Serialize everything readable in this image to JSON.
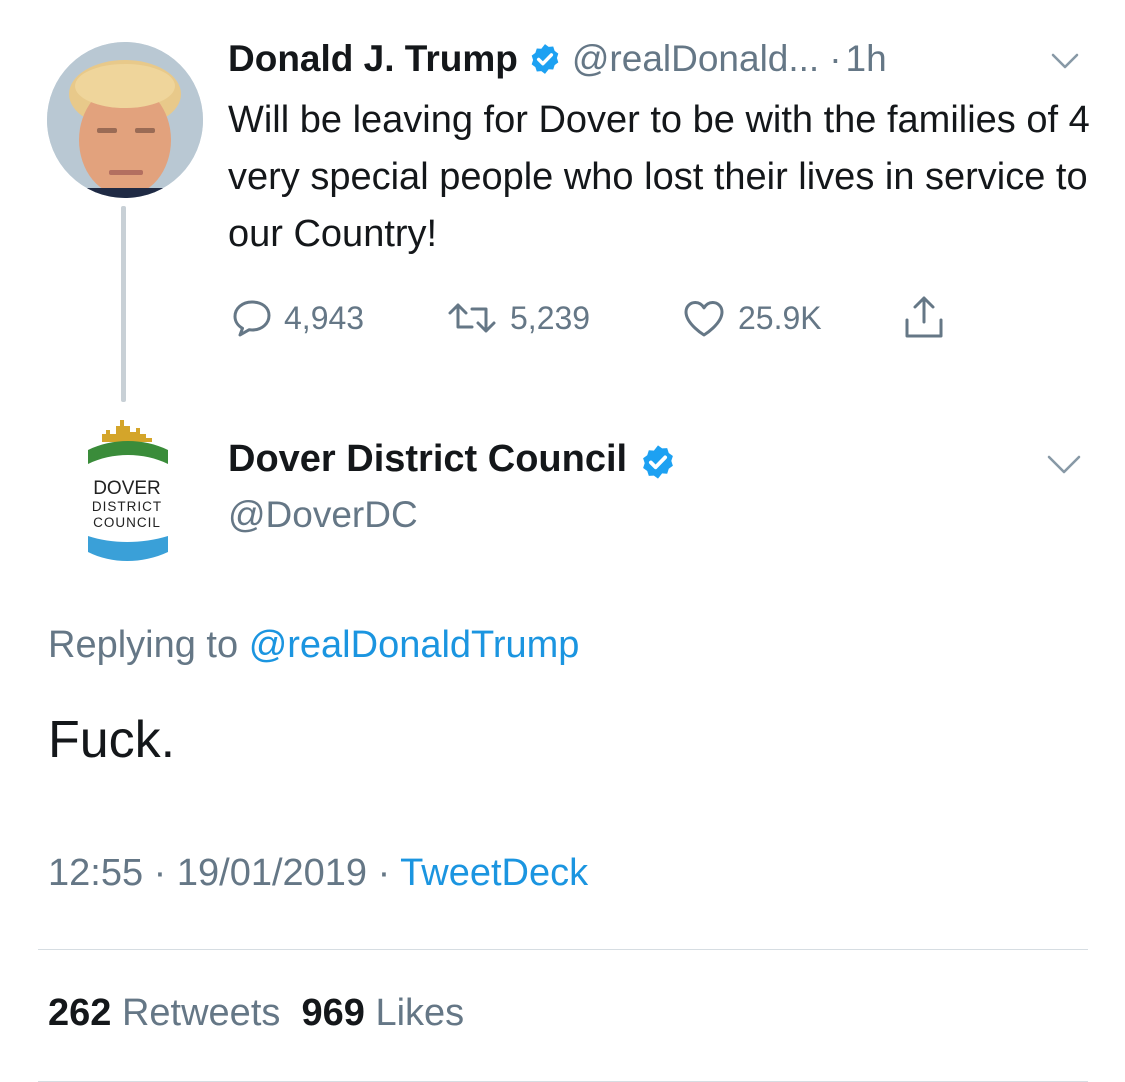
{
  "parent_tweet": {
    "author_name": "Donald J. Trump",
    "author_handle": "@realDonald...",
    "separator": "·",
    "time_ago": "1h",
    "text": "Will be leaving for Dover to be with the families of 4 very special people who lost their lives in service to our Country!",
    "reply_count": "4,943",
    "retweet_count": "5,239",
    "like_count": "25.9K",
    "avatar_icon": "trump-avatar",
    "verified_icon": "verified-badge-icon"
  },
  "reply_tweet": {
    "author_name": "Dover District Council",
    "author_handle": "@DoverDC",
    "logo_text": [
      "DOVER",
      "DISTRICT",
      "COUNCIL"
    ],
    "replying_prefix": "Replying to",
    "replying_to": "@realDonaldTrump",
    "text": "Fuck.",
    "time": "12:55",
    "dot": "·",
    "date": "19/01/2019",
    "source": "TweetDeck",
    "retweets_count": "262",
    "retweets_label": "Retweets",
    "likes_count": "969",
    "likes_label": "Likes"
  },
  "colors": {
    "accent": "#1b95e0",
    "verified": "#1da1f2",
    "muted": "#657786",
    "text": "#14171a",
    "logo_green": "#3a8c3a",
    "logo_blue": "#3aa0d8",
    "logo_gold": "#d4a52a"
  }
}
